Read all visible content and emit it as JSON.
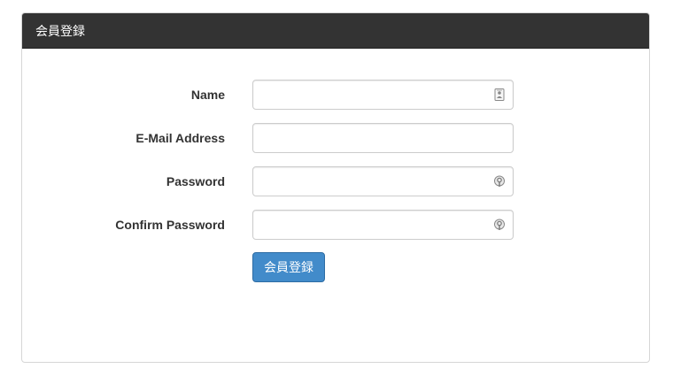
{
  "panel": {
    "title": "会員登録"
  },
  "form": {
    "fields": [
      {
        "label": "Name",
        "value": "",
        "type": "text",
        "icon": "contact-card-icon"
      },
      {
        "label": "E-Mail Address",
        "value": "",
        "type": "email",
        "icon": ""
      },
      {
        "label": "Password",
        "value": "",
        "type": "password",
        "icon": "password-key-icon"
      },
      {
        "label": "Confirm Password",
        "value": "",
        "type": "password",
        "icon": "password-key-icon"
      }
    ],
    "submit_label": "会員登録"
  },
  "colors": {
    "header_bg": "#333333",
    "button_bg": "#428bca",
    "button_border": "#2e6da4",
    "panel_border": "#d6d6d6"
  }
}
